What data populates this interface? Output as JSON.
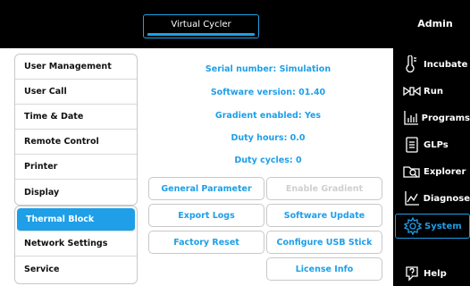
{
  "header": {
    "title": "Virtual Cycler",
    "user": "Admin"
  },
  "nav": [
    {
      "label": "Incubate",
      "icon": "thermometer-icon"
    },
    {
      "label": "Run",
      "icon": "run-icon"
    },
    {
      "label": "Programs",
      "icon": "programs-icon"
    },
    {
      "label": "GLPs",
      "icon": "document-icon"
    },
    {
      "label": "Explorer",
      "icon": "folder-search-icon"
    },
    {
      "label": "Diagnose",
      "icon": "diagnose-icon"
    },
    {
      "label": "System",
      "icon": "gear-icon",
      "active": true
    },
    {
      "label": "Help",
      "icon": "help-icon"
    }
  ],
  "menu_group1": [
    "User Management",
    "User Call",
    "Time & Date",
    "Remote Control",
    "Printer",
    "Display"
  ],
  "menu_group2": [
    "Thermal Block",
    "Network Settings",
    "Service"
  ],
  "selected_menu_item": "Thermal Block",
  "info": {
    "serial": "Serial number: Simulation",
    "software": "Software version: 01.40",
    "gradient": "Gradient enabled: Yes",
    "duty_hours": "Duty hours: 0.0",
    "duty_cycles": "Duty cycles: 0"
  },
  "buttons": {
    "general_parameter": "General Parameter",
    "enable_gradient": "Enable Gradient",
    "export_logs": "Export Logs",
    "software_update": "Software Update",
    "factory_reset": "Factory Reset",
    "configure_usb": "Configure USB Stick",
    "license_info": "License Info"
  },
  "colors": {
    "accent": "#1e9fe8",
    "background": "#000000",
    "disabled_text": "#cfcfcf"
  }
}
